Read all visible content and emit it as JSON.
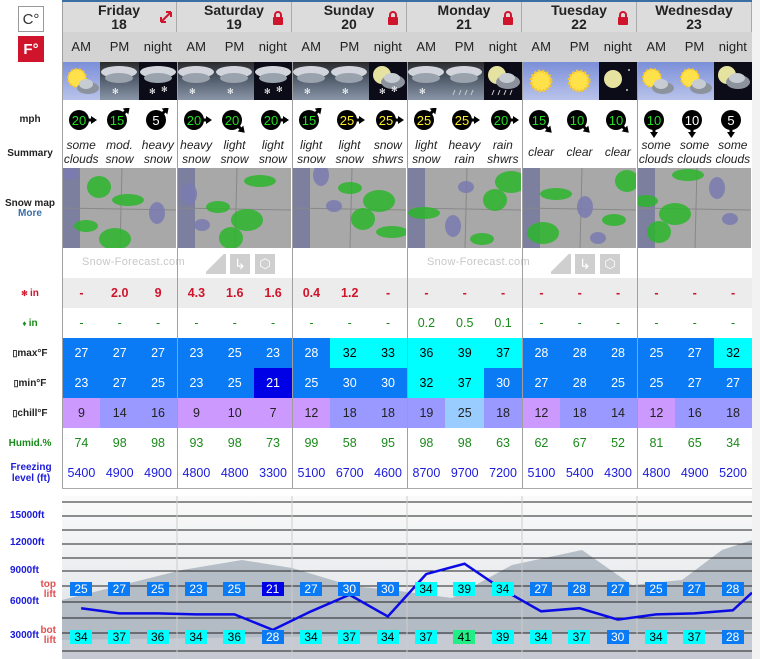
{
  "units": {
    "celsius": "C°",
    "fahrenheit": "F°",
    "active": "fahrenheit"
  },
  "days": [
    {
      "name": "Friday",
      "date": "18",
      "icon": "expand-icon"
    },
    {
      "name": "Saturday",
      "date": "19",
      "icon": "lock-icon"
    },
    {
      "name": "Sunday",
      "date": "20",
      "icon": "lock-icon"
    },
    {
      "name": "Monday",
      "date": "21",
      "icon": "lock-icon"
    },
    {
      "name": "Tuesday",
      "date": "22",
      "icon": "lock-icon"
    },
    {
      "name": "Wednesday",
      "date": "23",
      "icon": ""
    }
  ],
  "periods": [
    "AM",
    "PM",
    "night"
  ],
  "weather_icons": [
    "sun-cloud",
    "snow-cloud",
    "snow-night",
    "snow-cloud",
    "snow-cloud",
    "snow-night",
    "snow-cloud",
    "snow-cloud",
    "moon-cloud-snow",
    "snow-cloud",
    "rain-cloud",
    "moon-cloud-rain",
    "sun",
    "sun",
    "moon",
    "sun-cloud",
    "sun-cloud",
    "moon-cloud"
  ],
  "labels": {
    "wind": "mph",
    "summary": "Summary",
    "snow_map": "Snow map",
    "snow_map_more": "More",
    "snow": "in",
    "rain": "in",
    "max": "max°F",
    "min": "min°F",
    "chill": "chill°F",
    "humid": "Humid.%",
    "freezing": "Freezing level (ft)",
    "brand": "Snow-Forecast.com"
  },
  "wind": [
    {
      "speed": "20",
      "dir": "E",
      "color": "#22dd22"
    },
    {
      "speed": "15",
      "dir": "NE",
      "color": "#22dd22"
    },
    {
      "speed": "5",
      "dir": "NE",
      "color": "#ffffff"
    },
    {
      "speed": "20",
      "dir": "E",
      "color": "#22dd22"
    },
    {
      "speed": "20",
      "dir": "SE",
      "color": "#22dd22"
    },
    {
      "speed": "20",
      "dir": "E",
      "color": "#22dd22"
    },
    {
      "speed": "15",
      "dir": "NE",
      "color": "#22dd22"
    },
    {
      "speed": "25",
      "dir": "E",
      "color": "#ffee22"
    },
    {
      "speed": "25",
      "dir": "E",
      "color": "#ffee22"
    },
    {
      "speed": "25",
      "dir": "NE",
      "color": "#ffee22"
    },
    {
      "speed": "25",
      "dir": "E",
      "color": "#ffee22"
    },
    {
      "speed": "20",
      "dir": "E",
      "color": "#22dd22"
    },
    {
      "speed": "15",
      "dir": "SE",
      "color": "#22dd22"
    },
    {
      "speed": "10",
      "dir": "SE",
      "color": "#22dd22"
    },
    {
      "speed": "10",
      "dir": "SE",
      "color": "#22dd22"
    },
    {
      "speed": "10",
      "dir": "S",
      "color": "#22dd22"
    },
    {
      "speed": "10",
      "dir": "S",
      "color": "#ffffff"
    },
    {
      "speed": "5",
      "dir": "S",
      "color": "#ffffff"
    }
  ],
  "summary": [
    [
      "some",
      "clouds"
    ],
    [
      "mod.",
      "snow"
    ],
    [
      "heavy",
      "snow"
    ],
    [
      "heavy",
      "snow"
    ],
    [
      "light",
      "snow"
    ],
    [
      "light",
      "snow"
    ],
    [
      "light",
      "snow"
    ],
    [
      "light",
      "snow"
    ],
    [
      "snow",
      "shwrs"
    ],
    [
      "light",
      "snow"
    ],
    [
      "heavy",
      "rain"
    ],
    [
      "rain",
      "shwrs"
    ],
    [
      "",
      "clear"
    ],
    [
      "",
      "clear"
    ],
    [
      "",
      "clear"
    ],
    [
      "some",
      "clouds"
    ],
    [
      "some",
      "clouds"
    ],
    [
      "some",
      "clouds"
    ]
  ],
  "snow_in": [
    "-",
    "2.0",
    "9",
    "4.3",
    "1.6",
    "1.6",
    "0.4",
    "1.2",
    "-",
    "-",
    "-",
    "-",
    "-",
    "-",
    "-",
    "-",
    "-",
    "-"
  ],
  "rain_in": [
    "-",
    "-",
    "-",
    "-",
    "-",
    "-",
    "-",
    "-",
    "-",
    "0.2",
    "0.5",
    "0.1",
    "-",
    "-",
    "-",
    "-",
    "-",
    "-"
  ],
  "max_f": [
    "27",
    "27",
    "27",
    "23",
    "25",
    "23",
    "28",
    "32",
    "33",
    "36",
    "39",
    "37",
    "28",
    "28",
    "28",
    "25",
    "27",
    "32"
  ],
  "min_f": [
    "23",
    "27",
    "25",
    "23",
    "25",
    "21",
    "25",
    "30",
    "30",
    "32",
    "37",
    "30",
    "27",
    "28",
    "25",
    "25",
    "27",
    "27"
  ],
  "chill_f": [
    "9",
    "14",
    "16",
    "9",
    "10",
    "7",
    "12",
    "18",
    "18",
    "19",
    "25",
    "18",
    "12",
    "18",
    "14",
    "12",
    "16",
    "18"
  ],
  "humid": [
    "74",
    "98",
    "98",
    "93",
    "98",
    "73",
    "99",
    "58",
    "95",
    "98",
    "98",
    "63",
    "62",
    "67",
    "52",
    "81",
    "65",
    "34"
  ],
  "freezing": [
    "5400",
    "4900",
    "4900",
    "4800",
    "4800",
    "3300",
    "5100",
    "6700",
    "4600",
    "8700",
    "9700",
    "7200",
    "5100",
    "5400",
    "4300",
    "4800",
    "4900",
    "5200"
  ],
  "chart": {
    "axis_labels": [
      "15000ft",
      "12000ft",
      "9000ft",
      "6000ft",
      "3000ft"
    ],
    "top_lift_label": "top lift",
    "bot_lift_label": "bot lift",
    "top_lift": [
      "25",
      "27",
      "25",
      "23",
      "25",
      "21",
      "27",
      "30",
      "30",
      "34",
      "39",
      "34",
      "27",
      "28",
      "27",
      "25",
      "27",
      "28"
    ],
    "bot_lift": [
      "34",
      "37",
      "36",
      "34",
      "36",
      "28",
      "34",
      "37",
      "34",
      "37",
      "41",
      "39",
      "34",
      "37",
      "30",
      "34",
      "37",
      "28"
    ]
  },
  "colors": {
    "red": "#d0142c",
    "green": "#1a8a1a",
    "blue_text": "#1a1adb",
    "temp_blue": "#0a7bf5",
    "temp_dark": "#0000e6",
    "temp_cyan": "#00ffff",
    "temp_green": "#22ee88",
    "chill_purple": "#cc99ff",
    "chill_lavender": "#9999ff",
    "chill_light": "#99ccff"
  }
}
